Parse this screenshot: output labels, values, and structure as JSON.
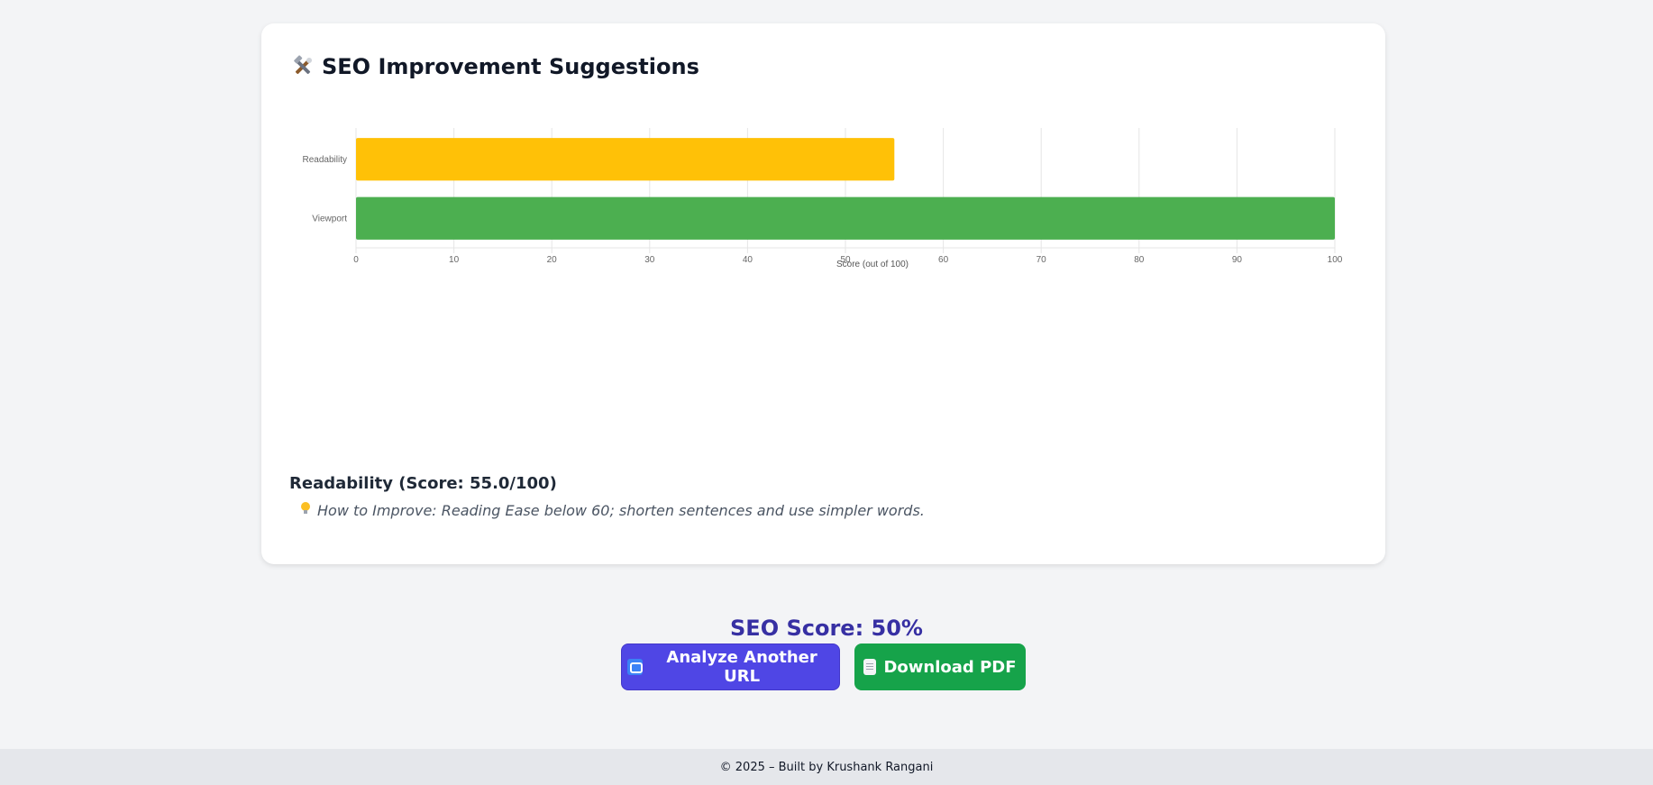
{
  "card": {
    "title": "SEO Improvement Suggestions",
    "icon": "tools-icon"
  },
  "chart_data": {
    "type": "bar",
    "orientation": "horizontal",
    "categories": [
      "Readability",
      "Viewport"
    ],
    "values": [
      55,
      100
    ],
    "colors": [
      "#ffc107",
      "#4caf50"
    ],
    "xlim": [
      0,
      100
    ],
    "xticks": [
      "0",
      "10",
      "20",
      "30",
      "40",
      "50",
      "60",
      "70",
      "80",
      "90",
      "100"
    ],
    "xlabel": "Score (out of 100)",
    "grid": true
  },
  "suggestion": {
    "title": "Readability (Score: 55.0/100)",
    "tip_icon": "lightbulb-icon",
    "tip": "How to Improve: Reading Ease below 60; shorten sentences and use simpler words."
  },
  "summary": {
    "score_text": "SEO Score: 50%"
  },
  "actions": {
    "analyze_label": "Analyze Another URL",
    "analyze_icon": "repeat-icon",
    "pdf_label": "Download PDF",
    "pdf_icon": "document-icon"
  },
  "footer": {
    "text": "© 2025 – Built by Krushank Rangani"
  }
}
